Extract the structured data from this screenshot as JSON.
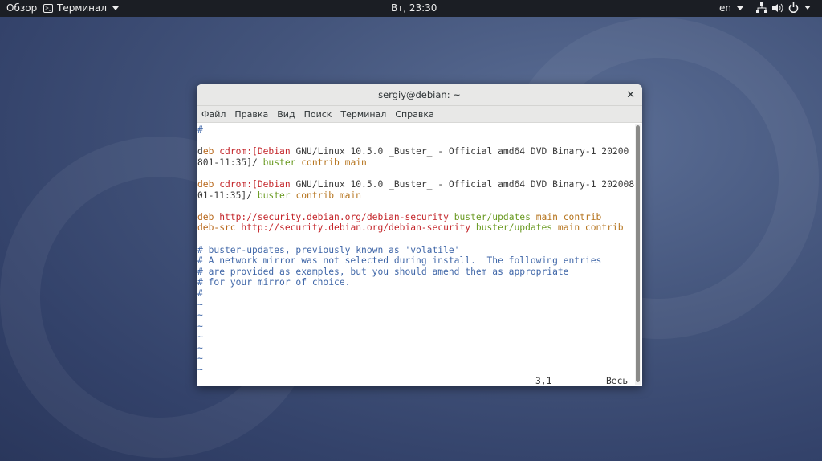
{
  "panel": {
    "overview": "Обзор",
    "app": "Терминал",
    "clock": "Вт, 23:30",
    "lang": "en"
  },
  "window": {
    "title": "sergiy@debian: ~",
    "menu": [
      "Файл",
      "Правка",
      "Вид",
      "Поиск",
      "Терминал",
      "Справка"
    ]
  },
  "terminal": {
    "lines": [
      [
        {
          "t": "#",
          "c": "comment"
        }
      ],
      [],
      [
        {
          "t": "d",
          "c": "cursor"
        },
        {
          "t": "eb ",
          "c": "kw"
        },
        {
          "t": "cdrom:[Debian ",
          "c": "red"
        },
        {
          "t": "GNU/Linux 10.5.0 _Buster_ - Official amd64 DVD Binary-1 20200",
          "c": "normal"
        }
      ],
      [
        {
          "t": "801-11:35]/ ",
          "c": "normal"
        },
        {
          "t": "buster ",
          "c": "green"
        },
        {
          "t": "contrib main",
          "c": "brown"
        }
      ],
      [],
      [
        {
          "t": "deb ",
          "c": "kw"
        },
        {
          "t": "cdrom:[Debian ",
          "c": "red"
        },
        {
          "t": "GNU/Linux 10.5.0 _Buster_ - Official amd64 DVD Binary-1 202008",
          "c": "normal"
        }
      ],
      [
        {
          "t": "01-11:35]/ ",
          "c": "normal"
        },
        {
          "t": "buster ",
          "c": "green"
        },
        {
          "t": "contrib main",
          "c": "brown"
        }
      ],
      [],
      [
        {
          "t": "deb ",
          "c": "kw"
        },
        {
          "t": "http://security.debian.org/debian-security ",
          "c": "red"
        },
        {
          "t": "buster/updates ",
          "c": "green"
        },
        {
          "t": "main contrib",
          "c": "brown"
        }
      ],
      [
        {
          "t": "deb-src ",
          "c": "kw"
        },
        {
          "t": "http://security.debian.org/debian-security ",
          "c": "red"
        },
        {
          "t": "buster/updates ",
          "c": "green"
        },
        {
          "t": "main contrib",
          "c": "brown"
        }
      ],
      [],
      [
        {
          "t": "# buster-updates, previously known as 'volatile'",
          "c": "comment"
        }
      ],
      [
        {
          "t": "# A network mirror was not selected during install.  The following entries",
          "c": "comment"
        }
      ],
      [
        {
          "t": "# are provided as examples, but you should amend them as appropriate",
          "c": "comment"
        }
      ],
      [
        {
          "t": "# for your mirror of choice.",
          "c": "comment"
        }
      ],
      [
        {
          "t": "#",
          "c": "comment"
        }
      ],
      [
        {
          "t": "~",
          "c": "tilde"
        }
      ],
      [
        {
          "t": "~",
          "c": "tilde"
        }
      ],
      [
        {
          "t": "~",
          "c": "tilde"
        }
      ],
      [
        {
          "t": "~",
          "c": "tilde"
        }
      ],
      [
        {
          "t": "~",
          "c": "tilde"
        }
      ],
      [
        {
          "t": "~",
          "c": "tilde"
        }
      ],
      [
        {
          "t": "~",
          "c": "tilde"
        }
      ]
    ],
    "position": "3,1",
    "scroll": "Весь"
  }
}
